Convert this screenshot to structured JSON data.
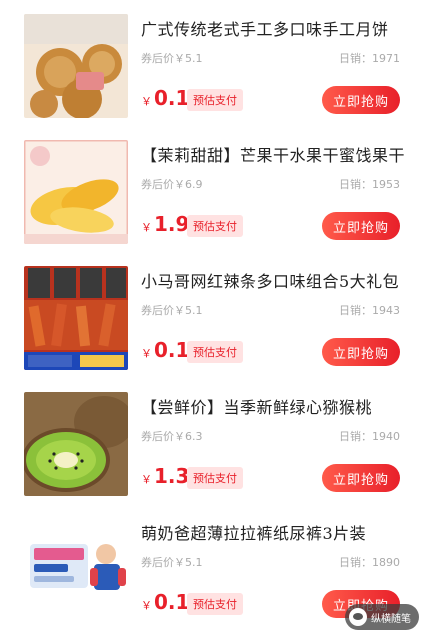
{
  "products": [
    {
      "title": "广式传统老式手工多口味手工月饼",
      "after_price": "券后价￥5.1",
      "sales": "日销：1971",
      "currency": "￥",
      "price": "0.1",
      "tag": "预估支付",
      "button": "立即抢购",
      "image_icon": "mooncake-image"
    },
    {
      "title": "【茉莉甜甜】芒果干水果干蜜饯果干",
      "after_price": "券后价￥6.9",
      "sales": "日销：1953",
      "currency": "￥",
      "price": "1.9",
      "tag": "预估支付",
      "button": "立即抢购",
      "image_icon": "dried-mango-image"
    },
    {
      "title": "小马哥网红辣条多口味组合5大礼包",
      "after_price": "券后价￥5.1",
      "sales": "日销：1943",
      "currency": "￥",
      "price": "0.1",
      "tag": "预估支付",
      "button": "立即抢购",
      "image_icon": "spicy-strips-image"
    },
    {
      "title": "【尝鲜价】当季新鲜绿心猕猴桃",
      "after_price": "券后价￥6.3",
      "sales": "日销：1940",
      "currency": "￥",
      "price": "1.3",
      "tag": "预估支付",
      "button": "立即抢购",
      "image_icon": "kiwi-image"
    },
    {
      "title": "萌奶爸超薄拉拉裤纸尿裤3片装",
      "after_price": "券后价￥5.1",
      "sales": "日销：1890",
      "currency": "￥",
      "price": "0.1",
      "tag": "预估支付",
      "button": "立即抢购",
      "image_icon": "diaper-image"
    }
  ],
  "watermark": {
    "text": "纵横随笔"
  },
  "colors": {
    "accent": "#e8202a",
    "tag_bg": "#ffe2e2"
  }
}
